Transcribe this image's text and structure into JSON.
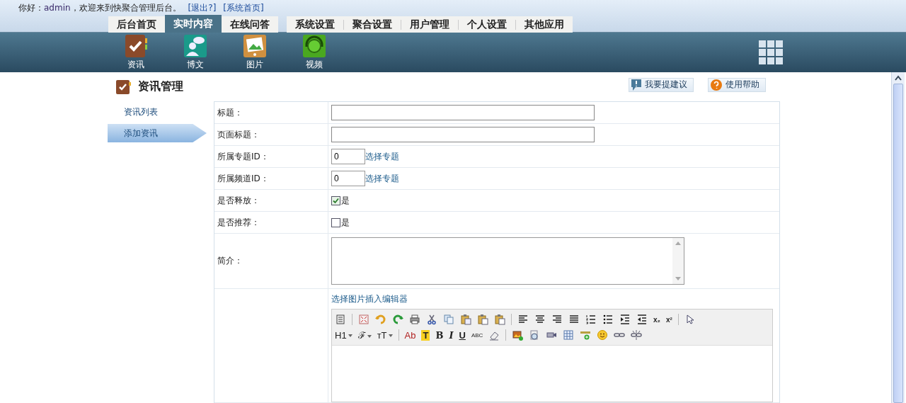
{
  "header": {
    "greeting": "你好：",
    "user": "admin",
    "welcome": "，欢迎来到快聚合管理后台。",
    "links": [
      "[退出?]",
      "[系统首页]"
    ]
  },
  "tab_groups": [
    [
      {
        "label": "后台首页",
        "selected": false
      },
      {
        "label": "实时内容",
        "selected": true
      },
      {
        "label": "在线问答",
        "selected": false
      }
    ],
    [
      {
        "label": "系统设置",
        "selected": false
      },
      {
        "label": "聚合设置",
        "selected": false
      },
      {
        "label": "用户管理",
        "selected": false
      },
      {
        "label": "个人设置",
        "selected": false
      },
      {
        "label": "其他应用",
        "selected": false
      }
    ]
  ],
  "app_icons": [
    {
      "label": "资讯"
    },
    {
      "label": "博文"
    },
    {
      "label": "图片"
    },
    {
      "label": "视频"
    }
  ],
  "section": {
    "title": "资讯管理",
    "actions": [
      "我要提建议",
      "使用帮助"
    ]
  },
  "sidebar": [
    {
      "label": "资讯列表",
      "selected": false
    },
    {
      "label": "添加资讯",
      "selected": true
    }
  ],
  "form": [
    {
      "kind": "text",
      "label": "标题："
    },
    {
      "kind": "text",
      "label": "页面标题："
    },
    {
      "kind": "id",
      "label": "所属专题ID：",
      "value": "0",
      "link": "选择专题"
    },
    {
      "kind": "id",
      "label": "所属频道ID：",
      "value": "0",
      "link": "选择专题"
    },
    {
      "kind": "checkbox",
      "label": "是否释放：",
      "option": "是",
      "checked": true
    },
    {
      "kind": "checkbox",
      "label": "是否推荐：",
      "option": "是",
      "checked": false
    },
    {
      "kind": "textarea",
      "label": "简介："
    },
    {
      "kind": "editor",
      "link": "选择图片插入编辑器"
    }
  ],
  "editor_toolbar": [
    [
      {
        "kind": "icon"
      },
      {
        "kind": "sep"
      },
      {
        "kind": "icon"
      },
      {
        "kind": "icon"
      },
      {
        "kind": "icon"
      },
      {
        "kind": "icon"
      },
      {
        "kind": "icon"
      },
      {
        "kind": "icon"
      },
      {
        "kind": "icon"
      },
      {
        "kind": "icon"
      },
      {
        "kind": "icon"
      },
      {
        "kind": "sep"
      },
      {
        "kind": "icon"
      },
      {
        "kind": "icon"
      },
      {
        "kind": "icon"
      },
      {
        "kind": "icon"
      },
      {
        "kind": "icon"
      },
      {
        "kind": "icon"
      },
      {
        "kind": "icon"
      },
      {
        "kind": "icon"
      },
      {
        "kind": "text",
        "label": "x₂"
      },
      {
        "kind": "text",
        "label": "x²"
      },
      {
        "kind": "sep"
      },
      {
        "kind": "icon"
      }
    ],
    [
      {
        "kind": "menu",
        "label": "H1"
      },
      {
        "kind": "menu",
        "label": "ℱ"
      },
      {
        "kind": "menu",
        "label": "ᴛT"
      },
      {
        "kind": "sep"
      },
      {
        "kind": "text",
        "label": "Ab"
      },
      {
        "kind": "text",
        "label": "T"
      },
      {
        "kind": "text",
        "label": "B"
      },
      {
        "kind": "text",
        "label": "I"
      },
      {
        "kind": "text",
        "label": "U"
      },
      {
        "kind": "text",
        "label": "ABC"
      },
      {
        "kind": "icon"
      },
      {
        "kind": "sep"
      },
      {
        "kind": "icon"
      },
      {
        "kind": "icon"
      },
      {
        "kind": "icon"
      },
      {
        "kind": "icon"
      },
      {
        "kind": "icon"
      },
      {
        "kind": "icon"
      },
      {
        "kind": "icon"
      },
      {
        "kind": "icon"
      }
    ]
  ]
}
